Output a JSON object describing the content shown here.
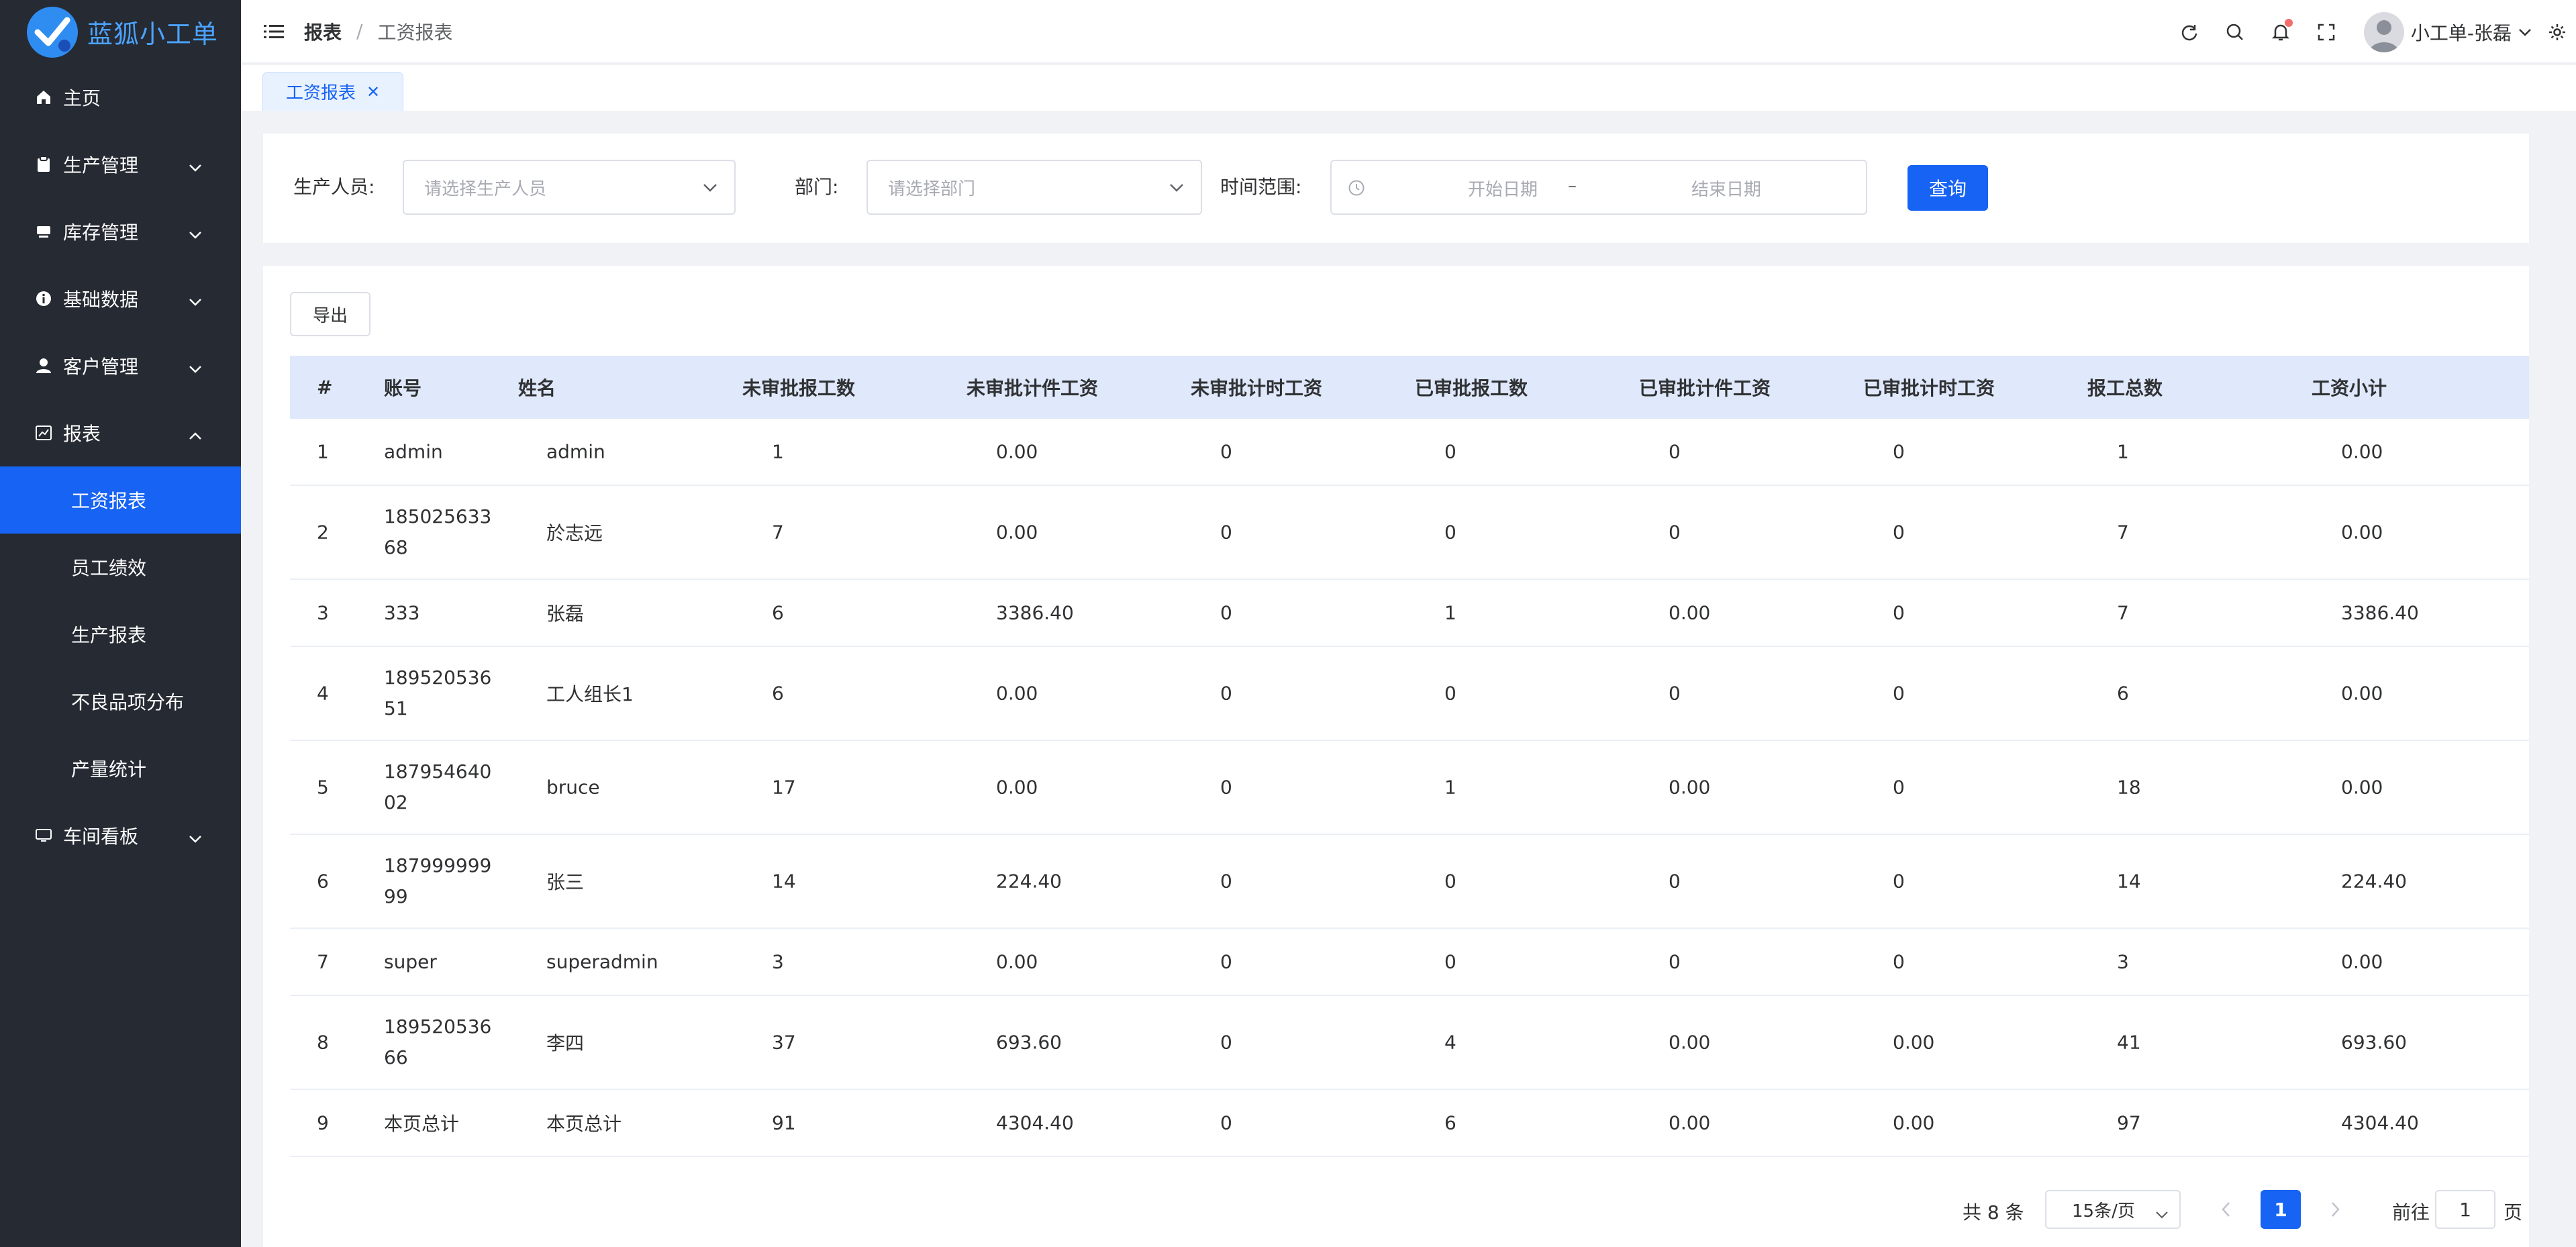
{
  "app": {
    "title": "蓝狐小工单"
  },
  "sidebar": {
    "items": [
      {
        "label": "主页",
        "icon": "home-icon"
      },
      {
        "label": "生产管理",
        "icon": "clipboard-icon"
      },
      {
        "label": "库存管理",
        "icon": "box-icon"
      },
      {
        "label": "基础数据",
        "icon": "info-icon"
      },
      {
        "label": "客户管理",
        "icon": "user-icon"
      },
      {
        "label": "报表",
        "icon": "chart-icon"
      },
      {
        "label": "车间看板",
        "icon": "monitor-icon"
      }
    ],
    "report_children": [
      "工资报表",
      "员工绩效",
      "生产报表",
      "不良品项分布",
      "产量统计"
    ],
    "active": "工资报表"
  },
  "header": {
    "breadcrumb": [
      "报表",
      "工资报表"
    ],
    "username": "小工单-张磊"
  },
  "tabs": [
    {
      "label": "工资报表",
      "active": true
    }
  ],
  "filters": {
    "producer_label": "生产人员:",
    "producer_placeholder": "请选择生产人员",
    "dept_label": "部门:",
    "dept_placeholder": "请选择部门",
    "time_label": "时间范围:",
    "start_placeholder": "开始日期",
    "range_sep": "–",
    "end_placeholder": "结束日期",
    "query_label": "查询"
  },
  "toolbar": {
    "export_label": "导出"
  },
  "table": {
    "headers": [
      "#",
      "账号",
      "姓名",
      "未审批报工数",
      "未审批计件工资",
      "未审批计时工资",
      "已审批报工数",
      "已审批计件工资",
      "已审批计时工资",
      "报工总数",
      "工资小计"
    ],
    "rows": [
      [
        "1",
        "admin",
        "admin",
        "1",
        "0.00",
        "0",
        "0",
        "0",
        "0",
        "1",
        "0.00"
      ],
      [
        "2",
        "18502563368",
        "於志远",
        "7",
        "0.00",
        "0",
        "0",
        "0",
        "0",
        "7",
        "0.00"
      ],
      [
        "3",
        "333",
        "张磊",
        "6",
        "3386.40",
        "0",
        "1",
        "0.00",
        "0",
        "7",
        "3386.40"
      ],
      [
        "4",
        "18952053651",
        "工人组长1",
        "6",
        "0.00",
        "0",
        "0",
        "0",
        "0",
        "6",
        "0.00"
      ],
      [
        "5",
        "18795464002",
        "bruce",
        "17",
        "0.00",
        "0",
        "1",
        "0.00",
        "0",
        "18",
        "0.00"
      ],
      [
        "6",
        "18799999999",
        "张三",
        "14",
        "224.40",
        "0",
        "0",
        "0",
        "0",
        "14",
        "224.40"
      ],
      [
        "7",
        "super",
        "superadmin",
        "3",
        "0.00",
        "0",
        "0",
        "0",
        "0",
        "3",
        "0.00"
      ],
      [
        "8",
        "18952053666",
        "李四",
        "37",
        "693.60",
        "0",
        "4",
        "0.00",
        "0.00",
        "41",
        "693.60"
      ],
      [
        "9",
        "本页总计",
        "本页总计",
        "91",
        "4304.40",
        "0",
        "6",
        "0.00",
        "0.00",
        "97",
        "4304.40"
      ]
    ]
  },
  "pagination": {
    "total": "共 8 条",
    "page_size": "15条/页",
    "current": "1",
    "goto_label": "前往",
    "goto_value": "1",
    "page_suffix": "页"
  },
  "colors": {
    "sidebar_bg": "#252a33",
    "primary": "#1763f3",
    "table_header_bg": "#dfe9fb"
  }
}
